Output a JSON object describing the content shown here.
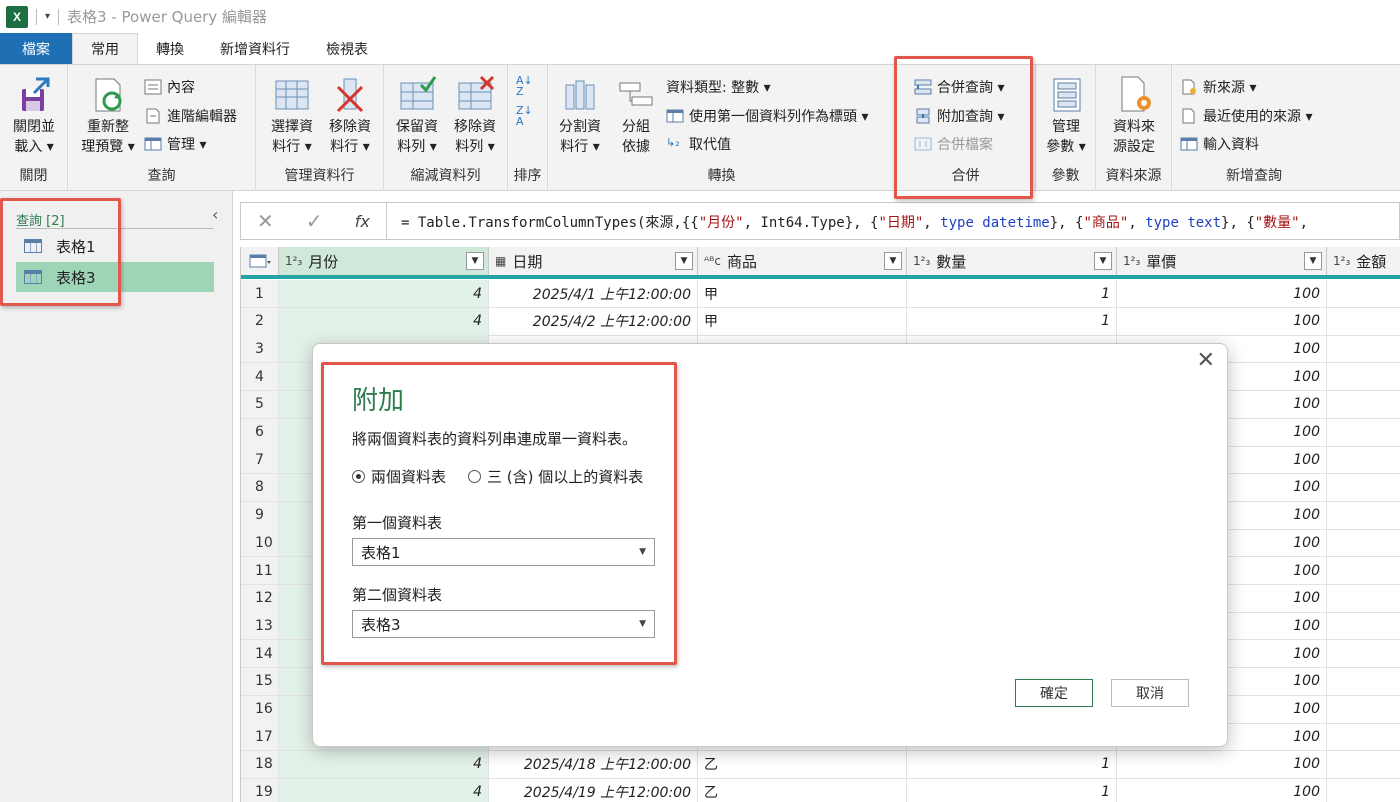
{
  "window": {
    "title": "表格3 - Power Query 編輯器",
    "app_logo": "X",
    "qat": "▾"
  },
  "tabs": {
    "file": "檔案",
    "home": "常用",
    "transform": "轉換",
    "add_column": "新增資料行",
    "view": "檢視表"
  },
  "ribbon": {
    "close": {
      "close_load": "關閉並\n載入 ▾",
      "label": "關閉"
    },
    "query": {
      "refresh": "重新整\n理預覽 ▾",
      "properties": "內容",
      "advanced_editor": "進階編輯器",
      "manage": "管理 ▾",
      "label": "查詢"
    },
    "manage_columns": {
      "choose": "選擇資\n料行 ▾",
      "remove": "移除資\n料行 ▾",
      "label": "管理資料行"
    },
    "reduce_rows": {
      "keep": "保留資\n料列 ▾",
      "remove": "移除資\n料列 ▾",
      "label": "縮減資料列"
    },
    "sort": {
      "label": "排序"
    },
    "transform": {
      "split": "分割資\n料行 ▾",
      "group": "分組\n依據",
      "data_type": "資料類型: 整數 ▾",
      "use_first_row": "使用第一個資料列作為標頭 ▾",
      "replace": "取代值",
      "label": "轉換"
    },
    "combine": {
      "merge": "合併查詢 ▾",
      "append": "附加查詢 ▾",
      "combine_files": "合併檔案",
      "label": "合併"
    },
    "parameters": {
      "manage": "管理\n參數 ▾",
      "label": "參數"
    },
    "data_source": {
      "settings": "資料來\n源設定",
      "label": "資料來源"
    },
    "new_query": {
      "new_source": "新來源 ▾",
      "recent": "最近使用的來源 ▾",
      "enter_data": "輸入資料",
      "label": "新增查詢"
    }
  },
  "queries": {
    "header": "查詢 [2]",
    "collapse": "‹",
    "items": [
      "表格1",
      "表格3"
    ]
  },
  "formula": {
    "cancel": "✕",
    "commit": "✓",
    "fx": "fx",
    "p1": "= Table.TransformColumnTypes(來源,{{",
    "s1": "\"月份\"",
    "p2": ", Int64.Type}, {",
    "s2": "\"日期\"",
    "p3": ", ",
    "k1": "type datetime",
    "p4": "}, {",
    "s3": "\"商品\"",
    "p5": ", ",
    "k2": "type text",
    "p6": "}, {",
    "s4": "\"數量\"",
    "p7": ","
  },
  "columns": [
    {
      "type": "1²₃",
      "name": "月份"
    },
    {
      "type": "▦",
      "name": "日期"
    },
    {
      "type": "ᴬᴮc",
      "name": "商品"
    },
    {
      "type": "1²₃",
      "name": "數量"
    },
    {
      "type": "1²₃",
      "name": "單價"
    },
    {
      "type": "1²₃",
      "name": "金額"
    }
  ],
  "rows": [
    [
      "1",
      "4",
      "2025/4/1 上午12:00:00",
      "甲",
      "1",
      "100"
    ],
    [
      "2",
      "4",
      "2025/4/2 上午12:00:00",
      "甲",
      "1",
      "100"
    ],
    [
      "3",
      "",
      "",
      "",
      "",
      "100"
    ],
    [
      "4",
      "",
      "",
      "",
      "",
      "100"
    ],
    [
      "5",
      "",
      "",
      "",
      "",
      "100"
    ],
    [
      "6",
      "",
      "",
      "",
      "",
      "100"
    ],
    [
      "7",
      "",
      "",
      "",
      "",
      "100"
    ],
    [
      "8",
      "",
      "",
      "",
      "",
      "100"
    ],
    [
      "9",
      "",
      "",
      "",
      "",
      "100"
    ],
    [
      "10",
      "",
      "",
      "",
      "",
      "100"
    ],
    [
      "11",
      "",
      "",
      "",
      "",
      "100"
    ],
    [
      "12",
      "",
      "",
      "",
      "",
      "100"
    ],
    [
      "13",
      "",
      "",
      "",
      "",
      "100"
    ],
    [
      "14",
      "",
      "",
      "",
      "",
      "100"
    ],
    [
      "15",
      "",
      "",
      "",
      "",
      "100"
    ],
    [
      "16",
      "",
      "",
      "",
      "",
      "100"
    ],
    [
      "17",
      "",
      "",
      "",
      "",
      "100"
    ],
    [
      "18",
      "4",
      "2025/4/18 上午12:00:00",
      "乙",
      "1",
      "100"
    ],
    [
      "19",
      "4",
      "2025/4/19 上午12:00:00",
      "乙",
      "1",
      "100"
    ]
  ],
  "dialog": {
    "close": "✕",
    "title": "附加",
    "description": "將兩個資料表的資料列串連成單一資料表。",
    "option_two": "兩個資料表",
    "option_three": "三 (含) 個以上的資料表",
    "first_label": "第一個資料表",
    "first_value": "表格1",
    "second_label": "第二個資料表",
    "second_value": "表格3",
    "ok": "確定",
    "cancel": "取消"
  },
  "colors": {
    "accent_green": "#2e7d4f",
    "file_tab": "#1f6fb5",
    "highlight_red": "#e2574c",
    "header_teal": "#23a3a3"
  }
}
